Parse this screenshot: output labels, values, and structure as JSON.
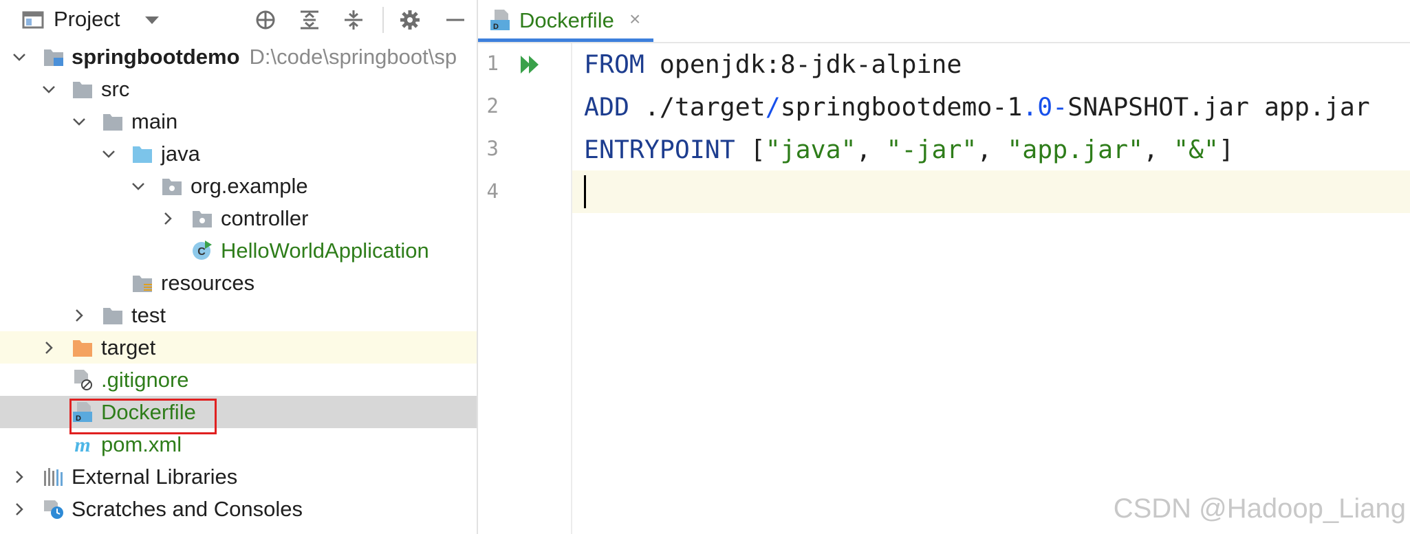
{
  "project_panel": {
    "title": "Project",
    "view_dropdown_icon": "chevron-down-icon",
    "toolbar_icons": [
      "crosshair-icon",
      "expand-all-icon",
      "collapse-all-icon",
      "gear-icon",
      "minimize-icon"
    ],
    "tree": {
      "root": {
        "name": "springbootdemo",
        "path": "D:\\code\\springboot\\sp"
      },
      "src": "src",
      "main": "main",
      "java": "java",
      "package": "org.example",
      "controller": "controller",
      "app_class": "HelloWorldApplication",
      "resources": "resources",
      "test": "test",
      "target": "target",
      "gitignore": ".gitignore",
      "dockerfile": "Dockerfile",
      "pom": "pom.xml",
      "external_libraries": "External Libraries",
      "scratches": "Scratches and Consoles"
    }
  },
  "editor": {
    "tab": {
      "label": "Dockerfile",
      "close": "×"
    },
    "line_numbers": [
      "1",
      "2",
      "3",
      "4"
    ],
    "lines": {
      "l1": {
        "kw": "FROM",
        "rest": " openjdk:8-jdk-alpine"
      },
      "l2": {
        "kw": "ADD",
        "a": " ./target",
        "slash": "/",
        "b": "springbootdemo-1",
        "dot": ".",
        "num": "0",
        "dash": "-",
        "c": "SNAPSHOT.jar app.jar"
      },
      "l3": {
        "kw": "ENTRYPOINT",
        "open": " [",
        "s1": "\"java\"",
        "c1": ", ",
        "s2": "\"-jar\"",
        "c2": ", ",
        "s3": "\"app.jar\"",
        "c3": ", ",
        "s4": "\"&\"",
        "close": "]"
      }
    }
  },
  "watermark": "CSDN @Hadoop_Liang",
  "colors": {
    "keyword": "#1d3d8f",
    "string": "#2e7d1a",
    "number": "#1750eb",
    "vcs_added": "#2e7d1a",
    "tab_underline": "#3d7fdc",
    "selection_box": "#e02020"
  }
}
